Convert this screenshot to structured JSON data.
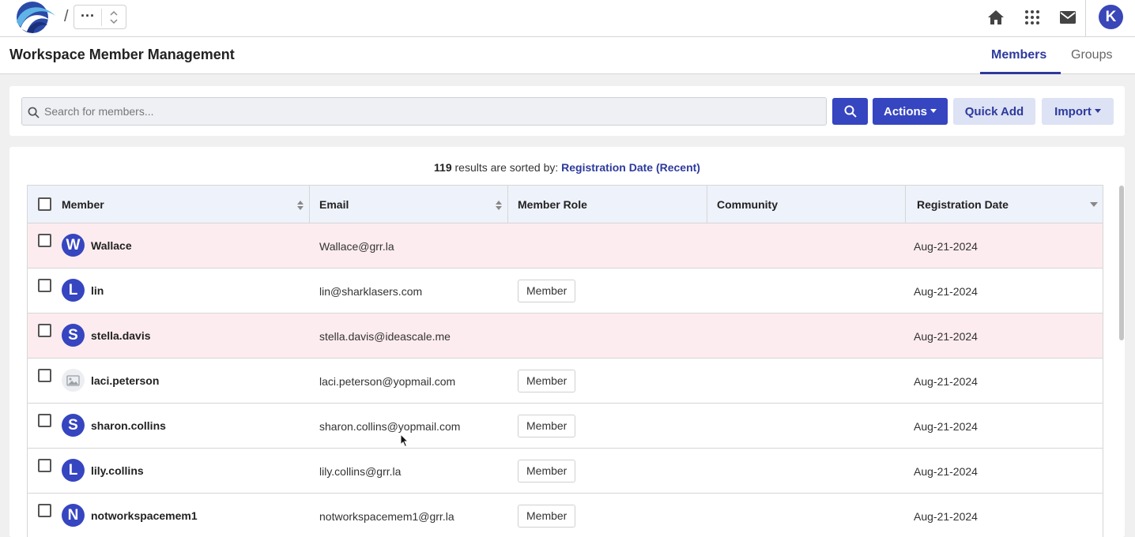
{
  "topbar": {
    "breadcrumb_sep": "/",
    "breadcrumb_more": "···",
    "icons": [
      "home-icon",
      "apps-grid-icon",
      "mail-icon"
    ],
    "user_initial": "K",
    "accent": "#3645c0"
  },
  "header": {
    "title": "Workspace Member Management",
    "tabs": [
      {
        "label": "Members",
        "active": true
      },
      {
        "label": "Groups",
        "active": false
      }
    ]
  },
  "search": {
    "placeholder": "Search for members...",
    "value": "",
    "actions_label": "Actions",
    "quick_add_label": "Quick Add",
    "import_label": "Import"
  },
  "results": {
    "count": "119",
    "text": " results are sorted by: ",
    "sort_key": "Registration Date (Recent)"
  },
  "table": {
    "columns": [
      "Member",
      "Email",
      "Member Role",
      "Community",
      "Registration Date"
    ],
    "rows": [
      {
        "initial": "W",
        "name": "Wallace",
        "email": "Wallace@grr.la",
        "role": "",
        "community": "",
        "date": "Aug-21-2024",
        "flagged": true
      },
      {
        "initial": "L",
        "name": "lin",
        "email": "lin@sharklasers.com",
        "role": "Member",
        "community": "",
        "date": "Aug-21-2024",
        "flagged": false
      },
      {
        "initial": "S",
        "name": "stella.davis",
        "email": "stella.davis@ideascale.me",
        "role": "",
        "community": "",
        "date": "Aug-21-2024",
        "flagged": true
      },
      {
        "initial": "",
        "name": "laci.peterson",
        "email": "laci.peterson@yopmail.com",
        "role": "Member",
        "community": "",
        "date": "Aug-21-2024",
        "flagged": false
      },
      {
        "initial": "S",
        "name": "sharon.collins",
        "email": "sharon.collins@yopmail.com",
        "role": "Member",
        "community": "",
        "date": "Aug-21-2024",
        "flagged": false
      },
      {
        "initial": "L",
        "name": "lily.collins",
        "email": "lily.collins@grr.la",
        "role": "Member",
        "community": "",
        "date": "Aug-21-2024",
        "flagged": false
      },
      {
        "initial": "N",
        "name": "notworkspacemem1",
        "email": "notworkspacemem1@grr.la",
        "role": "Member",
        "community": "",
        "date": "Aug-21-2024",
        "flagged": false
      }
    ]
  }
}
